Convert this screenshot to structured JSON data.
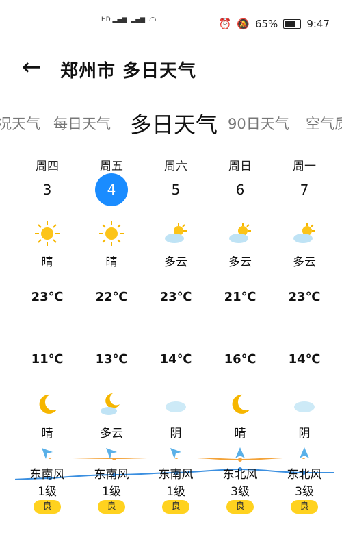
{
  "status_bar": {
    "battery": "65%",
    "time": "9:47"
  },
  "header": {
    "title": "郑州市 多日天气"
  },
  "tabs": [
    {
      "label": "况天气"
    },
    {
      "label": "每日天气"
    },
    {
      "label": "多日天气"
    },
    {
      "label": "90日天气"
    },
    {
      "label": "空气质"
    }
  ],
  "days": [
    {
      "dow": "周四",
      "date": "3",
      "day_desc": "晴",
      "high": "23℃",
      "low": "11℃",
      "night_desc": "晴",
      "wind": "东南风",
      "wind_level": "1级",
      "aqi": "良"
    },
    {
      "dow": "周五",
      "date": "4",
      "day_desc": "晴",
      "high": "22℃",
      "low": "13℃",
      "night_desc": "多云",
      "wind": "东南风",
      "wind_level": "1级",
      "aqi": "良"
    },
    {
      "dow": "周六",
      "date": "5",
      "day_desc": "多云",
      "high": "23℃",
      "low": "14℃",
      "night_desc": "阴",
      "wind": "东南风",
      "wind_level": "1级",
      "aqi": "良"
    },
    {
      "dow": "周日",
      "date": "6",
      "day_desc": "多云",
      "high": "21℃",
      "low": "16℃",
      "night_desc": "晴",
      "wind": "东北风",
      "wind_level": "3级",
      "aqi": "良"
    },
    {
      "dow": "周一",
      "date": "7",
      "day_desc": "多云",
      "high": "23℃",
      "low": "14℃",
      "night_desc": "阴",
      "wind": "东北风",
      "wind_level": "3级",
      "aqi": "良"
    }
  ],
  "colors": {
    "accent": "#1a8cff",
    "high_line": "#f3a33a",
    "low_line": "#3b8fe0",
    "aqi_good": "#ffd21f"
  }
}
